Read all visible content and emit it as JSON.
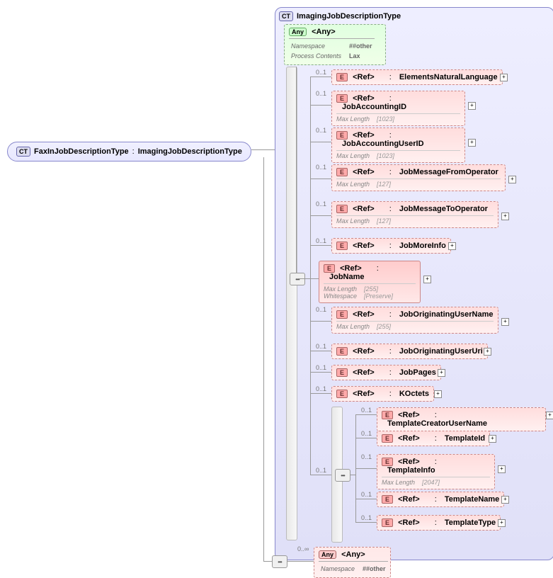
{
  "root": {
    "badge": "CT",
    "name": "FaxInJobDescriptionType",
    "base": "ImagingJobDescriptionType"
  },
  "imaging": {
    "badge": "CT",
    "name": "ImagingJobDescriptionType"
  },
  "anyTop": {
    "badge": "Any",
    "label": "<Any>",
    "ns_label": "Namespace",
    "ns_val": "##other",
    "pc_label": "Process Contents",
    "pc_val": "Lax"
  },
  "elems": [
    {
      "occ": "0..1",
      "ref": "<Ref>",
      "name": "ElementsNaturalLanguage",
      "dashed": true
    },
    {
      "occ": "0..1",
      "ref": "<Ref>",
      "name": "JobAccountingID",
      "dashed": true,
      "c1l": "Max Length",
      "c1v": "[1023]"
    },
    {
      "occ": "0..1",
      "ref": "<Ref>",
      "name": "JobAccountingUserID",
      "dashed": true,
      "c1l": "Max Length",
      "c1v": "[1023]"
    },
    {
      "occ": "0..1",
      "ref": "<Ref>",
      "name": "JobMessageFromOperator",
      "dashed": true,
      "c1l": "Max Length",
      "c1v": "[127]"
    },
    {
      "occ": "0..1",
      "ref": "<Ref>",
      "name": "JobMessageToOperator",
      "dashed": true,
      "c1l": "Max Length",
      "c1v": "[127]"
    },
    {
      "occ": "0..1",
      "ref": "<Ref>",
      "name": "JobMoreInfo",
      "dashed": true
    },
    {
      "occ": "",
      "ref": "<Ref>",
      "name": "JobName",
      "dashed": false,
      "c1l": "Max Length",
      "c1v": "[255]",
      "c2l": "Whitespace",
      "c2v": "[Preserve]"
    },
    {
      "occ": "0..1",
      "ref": "<Ref>",
      "name": "JobOriginatingUserName",
      "dashed": true,
      "c1l": "Max Length",
      "c1v": "[255]"
    },
    {
      "occ": "0..1",
      "ref": "<Ref>",
      "name": "JobOriginatingUserUri",
      "dashed": true
    },
    {
      "occ": "0..1",
      "ref": "<Ref>",
      "name": "JobPages",
      "dashed": true
    },
    {
      "occ": "0..1",
      "ref": "<Ref>",
      "name": "KOctets",
      "dashed": true
    }
  ],
  "nested_occ": "0..1",
  "nested": [
    {
      "occ": "0..1",
      "ref": "<Ref>",
      "name": "TemplateCreatorUserName",
      "dashed": true
    },
    {
      "occ": "0..1",
      "ref": "<Ref>",
      "name": "TemplateId",
      "dashed": true
    },
    {
      "occ": "0..1",
      "ref": "<Ref>",
      "name": "TemplateInfo",
      "dashed": true,
      "c1l": "Max Length",
      "c1v": "[2047]"
    },
    {
      "occ": "0..1",
      "ref": "<Ref>",
      "name": "TemplateName",
      "dashed": true
    },
    {
      "occ": "0..1",
      "ref": "<Ref>",
      "name": "TemplateType",
      "dashed": true
    }
  ],
  "anyBottom": {
    "occ": "0..∞",
    "badge": "Any",
    "label": "<Any>",
    "ns_label": "Namespace",
    "ns_val": "##other"
  },
  "colon": ":",
  "plus": "+"
}
